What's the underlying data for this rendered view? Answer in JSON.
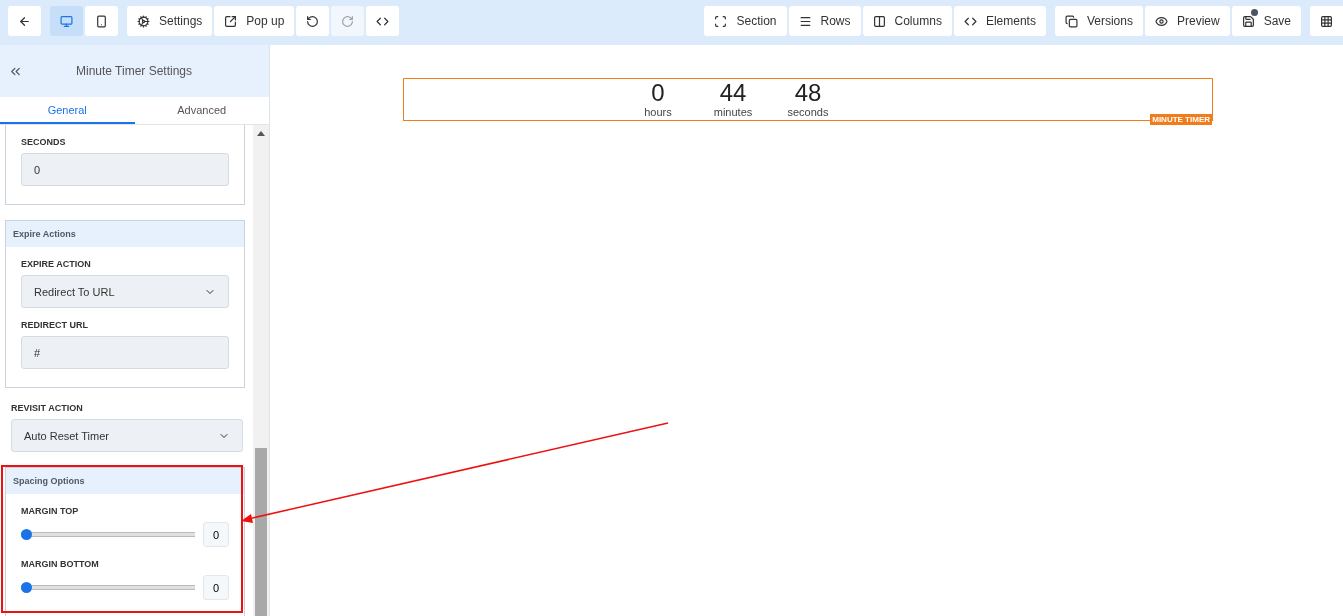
{
  "toolbar": {
    "left": [
      {
        "buttons": [
          {
            "kind": "back"
          }
        ]
      },
      {
        "buttons": [
          {
            "kind": "desktop",
            "selected": true
          },
          {
            "kind": "mobile",
            "selected": false
          }
        ]
      },
      {
        "buttons": [
          {
            "kind": "settings",
            "label": "Settings"
          },
          {
            "kind": "popup",
            "label": "Pop up"
          },
          {
            "kind": "undo",
            "disabled": false
          },
          {
            "kind": "redo",
            "disabled": true
          },
          {
            "kind": "code"
          }
        ]
      }
    ],
    "right": [
      {
        "buttons": [
          {
            "kind": "section",
            "label": "Section"
          },
          {
            "kind": "rows",
            "label": "Rows"
          },
          {
            "kind": "columns",
            "label": "Columns"
          },
          {
            "kind": "code",
            "label": "Elements"
          }
        ]
      },
      {
        "buttons": [
          {
            "kind": "versions",
            "label": "Versions"
          },
          {
            "kind": "preview",
            "label": "Preview"
          },
          {
            "kind": "save",
            "label": "Save",
            "dot": true
          }
        ]
      },
      {
        "buttons": [
          {
            "kind": "grid"
          }
        ]
      }
    ]
  },
  "sidebar": {
    "title": "Minute Timer Settings",
    "tabs": [
      {
        "label": "General",
        "selected": true
      },
      {
        "label": "Advanced",
        "selected": false
      }
    ],
    "sections": [
      {
        "kind": "card",
        "fields": [
          {
            "kind": "input",
            "label": "SECONDS",
            "value": "0"
          }
        ]
      },
      {
        "kind": "card",
        "title": "Expire Actions",
        "fields": [
          {
            "kind": "select",
            "label": "EXPIRE ACTION",
            "value": "Redirect To URL"
          },
          {
            "kind": "input",
            "label": "REDIRECT URL",
            "value": "#"
          }
        ]
      },
      {
        "kind": "plain",
        "fields": [
          {
            "kind": "select",
            "label": "REVISIT ACTION",
            "value": "Auto Reset Timer"
          }
        ]
      },
      {
        "kind": "card",
        "title": "Spacing Options",
        "fields": [
          {
            "kind": "slider",
            "label": "MARGIN TOP",
            "level": 0,
            "value": "0"
          },
          {
            "kind": "slider",
            "label": "MARGIN BOTTOM",
            "level": 0,
            "value": "0"
          }
        ]
      }
    ]
  },
  "canvas": {
    "timer": {
      "units": [
        {
          "value": "0",
          "label": "hours"
        },
        {
          "value": "44",
          "label": "minutes"
        },
        {
          "value": "48",
          "label": "seconds"
        }
      ],
      "badge": "MINUTE TIMER"
    }
  }
}
